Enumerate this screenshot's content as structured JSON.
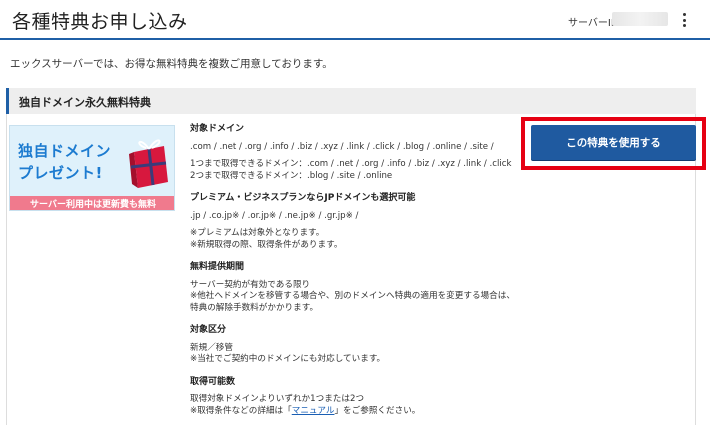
{
  "header": {
    "title": "各種特典お申し込み",
    "server_id_label": "サーバーID"
  },
  "intro": "エックスサーバーでは、お得な無料特典を複数ご用意しております。",
  "section": {
    "title": "独自ドメイン永久無料特典"
  },
  "banner": {
    "line1": "独自ドメイン",
    "line2": "プレゼント!",
    "strip": "サーバー利用中は更新費も無料"
  },
  "cta": {
    "label": "この特典を使用する",
    "highlight_color": "#e60012",
    "button_color": "#1f5aa0"
  },
  "details": {
    "target_domain": {
      "heading": "対象ドメイン",
      "list": ".com / .net / .org / .info / .biz / .xyz / .link / .click / .blog / .online / .site /",
      "one": "1つまで取得できるドメイン：.com / .net / .org / .info / .biz / .xyz / .link / .click",
      "two": "2つまで取得できるドメイン：.blog / .site / .online"
    },
    "premium": {
      "heading": "プレミアム・ビジネスプランならJPドメインも選択可能",
      "list": ".jp / .co.jp※ / .or.jp※ / .ne.jp※ / .gr.jp※ /",
      "note1": "※プレミアムは対象外となります。",
      "note2": "※新規取得の際、取得条件があります。"
    },
    "period": {
      "heading": "無料提供期間",
      "line1": "サーバー契約が有効である限り",
      "line2": "※他社へドメインを移管する場合や、別のドメインへ特典の適用を変更する場合は、",
      "line3": "特典の解除手数料がかかります。"
    },
    "category": {
      "heading": "対象区分",
      "line1": "新規／移管",
      "line2": "※当社でご契約中のドメインにも対応しています。"
    },
    "count": {
      "heading": "取得可能数",
      "line1": "取得対象ドメインよりいずれか1つまたは2つ",
      "line2_pre": "※取得条件などの詳細は「",
      "line2_link": "マニュアル",
      "line2_post": "」をご参照ください。"
    }
  }
}
